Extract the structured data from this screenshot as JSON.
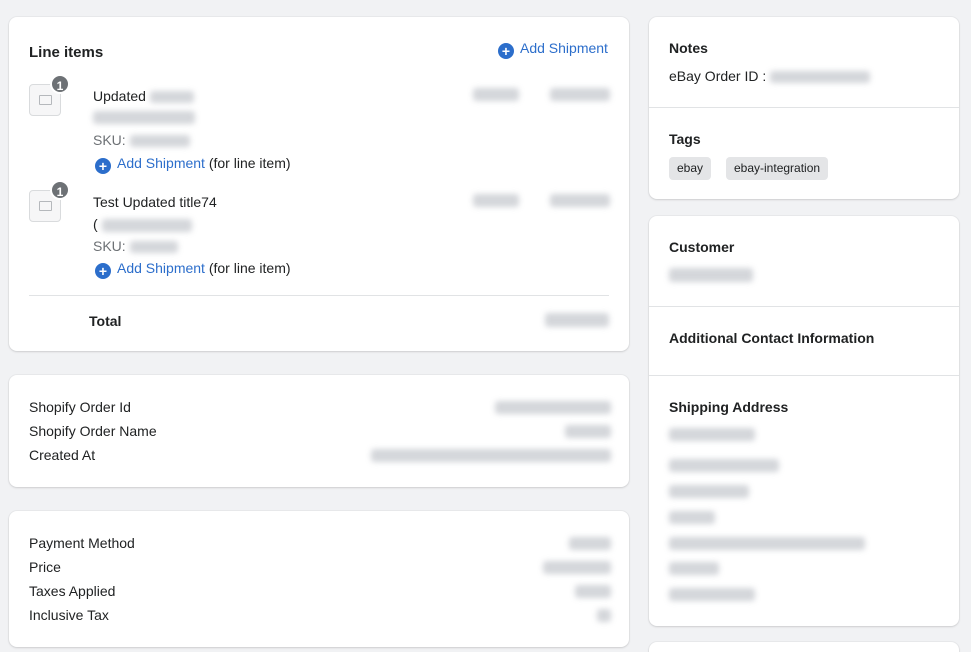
{
  "line_items": {
    "title": "Line items",
    "add_shipment": "Add Shipment",
    "items": [
      {
        "qty": "1",
        "title": "Updated",
        "sku_label": "SKU:",
        "add_shipment": "Add Shipment",
        "for_line_item": "(for line item)"
      },
      {
        "qty": "1",
        "title": "Test Updated title74",
        "prefix": "(",
        "sku_label": "SKU:",
        "add_shipment": "Add Shipment",
        "for_line_item": "(for line item)"
      }
    ],
    "total_label": "Total"
  },
  "order_info": {
    "rows": [
      "Shopify Order Id",
      "Shopify Order Name",
      "Created At"
    ]
  },
  "payment": {
    "rows": [
      "Payment Method",
      "Price",
      "Taxes Applied",
      "Inclusive Tax"
    ]
  },
  "notes": {
    "title": "Notes",
    "ebay_order_label": "eBay Order ID :"
  },
  "tags": {
    "title": "Tags",
    "items": [
      "ebay",
      "ebay-integration"
    ]
  },
  "customer": {
    "title": "Customer",
    "additional_contact": "Additional Contact Information",
    "shipping_address": "Shipping Address"
  }
}
